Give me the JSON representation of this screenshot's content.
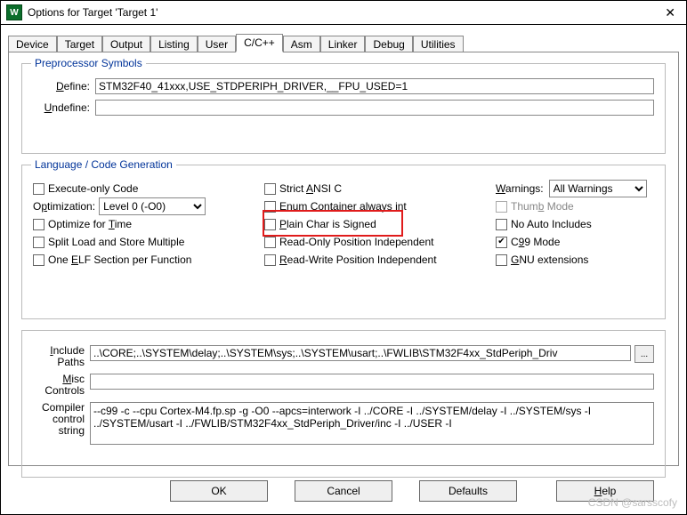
{
  "window": {
    "title": "Options for Target 'Target 1'",
    "icon_glyph": "W"
  },
  "tabs": [
    "Device",
    "Target",
    "Output",
    "Listing",
    "User",
    "C/C++",
    "Asm",
    "Linker",
    "Debug",
    "Utilities"
  ],
  "active_tab": "C/C++",
  "preproc": {
    "legend": "Preprocessor Symbols",
    "define_label": "Define:",
    "define_value": "STM32F40_41xxx,USE_STDPERIPH_DRIVER,__FPU_USED=1",
    "undefine_label": "Undefine:",
    "undefine_value": ""
  },
  "codegen": {
    "legend": "Language / Code Generation",
    "execute_only": {
      "label": "Execute-only Code",
      "checked": false
    },
    "optimization_label": "Optimization:",
    "optimization_value": "Level 0 (-O0)",
    "optimize_time": {
      "label": "Optimize for Time",
      "checked": false
    },
    "split_load": {
      "label": "Split Load and Store Multiple",
      "checked": false
    },
    "one_elf": {
      "label": "One ELF Section per Function",
      "checked": false
    },
    "strict_ansi": {
      "label": "Strict ANSI C",
      "checked": false
    },
    "enum_container": {
      "label": "Enum Container always int",
      "checked": false
    },
    "plain_char": {
      "label": "Plain Char is Signed",
      "checked": false
    },
    "ro_pi": {
      "label": "Read-Only Position Independent",
      "checked": false
    },
    "rw_pi": {
      "label": "Read-Write Position Independent",
      "checked": false
    },
    "warnings_label": "Warnings:",
    "warnings_value": "All Warnings",
    "thumb_mode": {
      "label": "Thumb Mode",
      "checked": false,
      "disabled": true
    },
    "no_auto_inc": {
      "label": "No Auto Includes",
      "checked": false
    },
    "c99": {
      "label": "C99 Mode",
      "checked": true
    },
    "gnu_ext": {
      "label": "GNU extensions",
      "checked": false
    }
  },
  "paths": {
    "include_label": "Include\nPaths",
    "include_value": "..\\CORE;..\\SYSTEM\\delay;..\\SYSTEM\\sys;..\\SYSTEM\\usart;..\\FWLIB\\STM32F4xx_StdPeriph_Driv",
    "misc_label": "Misc\nControls",
    "misc_value": "",
    "compiler_label": "Compiler\ncontrol\nstring",
    "compiler_value": "--c99 -c --cpu Cortex-M4.fp.sp -g -O0 --apcs=interwork -I ../CORE -I ../SYSTEM/delay -I ../SYSTEM/sys -I ../SYSTEM/usart -I ../FWLIB/STM32F4xx_StdPeriph_Driver/inc -I ../USER -I"
  },
  "buttons": {
    "ok": "OK",
    "cancel": "Cancel",
    "defaults": "Defaults",
    "help": "Help"
  },
  "watermark": "CSDN @sarsscofy"
}
